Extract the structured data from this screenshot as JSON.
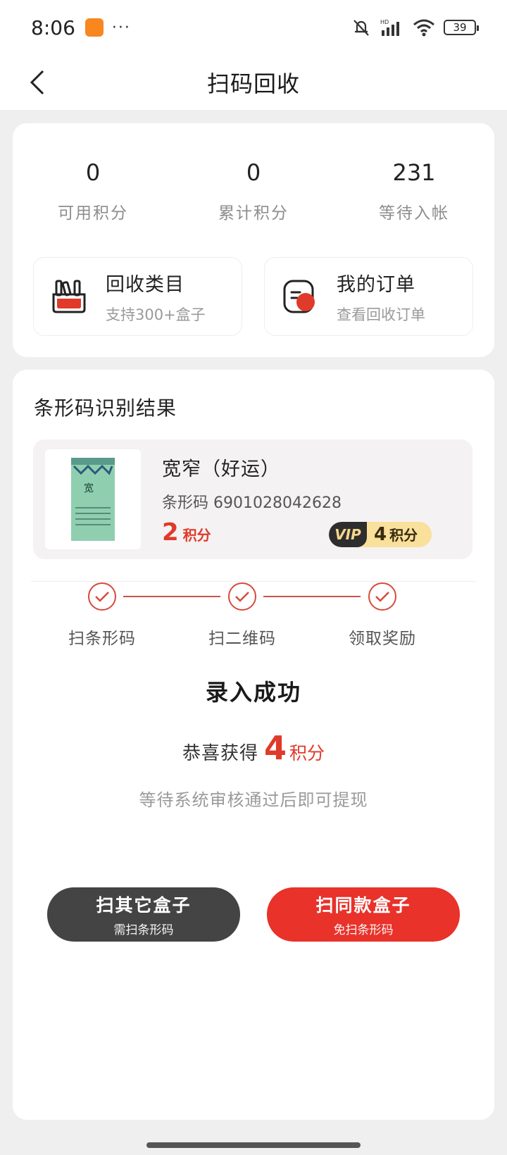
{
  "status_bar": {
    "time": "8:06",
    "dots": "···",
    "battery": "39"
  },
  "nav": {
    "title": "扫码回收"
  },
  "stats": [
    {
      "value": "0",
      "label": "可用积分"
    },
    {
      "value": "0",
      "label": "累计积分"
    },
    {
      "value": "231",
      "label": "等待入帐"
    }
  ],
  "shortcuts": {
    "category": {
      "title": "回收类目",
      "subtitle": "支持300+盒子"
    },
    "orders": {
      "title": "我的订单",
      "subtitle": "查看回收订单"
    }
  },
  "result": {
    "section_title": "条形码识别结果",
    "product": {
      "name": "宽窄（好运）",
      "barcode": "条形码 6901028042628",
      "points": "2",
      "points_unit": "积分",
      "vip_label": "VIP",
      "vip_points": "4",
      "vip_points_unit": "积分"
    },
    "steps": [
      "扫条形码",
      "扫二维码",
      "领取奖励"
    ],
    "success_title": "录入成功",
    "reward_prefix": "恭喜获得",
    "reward_points": "4",
    "reward_unit": "积分",
    "pending_note": "等待系统审核通过后即可提现",
    "buttons": {
      "scan_other": {
        "title": "扫其它盒子",
        "subtitle": "需扫条形码"
      },
      "scan_same": {
        "title": "扫同款盒子",
        "subtitle": "免扫条形码"
      }
    }
  },
  "colors": {
    "accent": "#e8322a",
    "dark_button": "#444444",
    "vip_gold": "#f9e09b"
  }
}
